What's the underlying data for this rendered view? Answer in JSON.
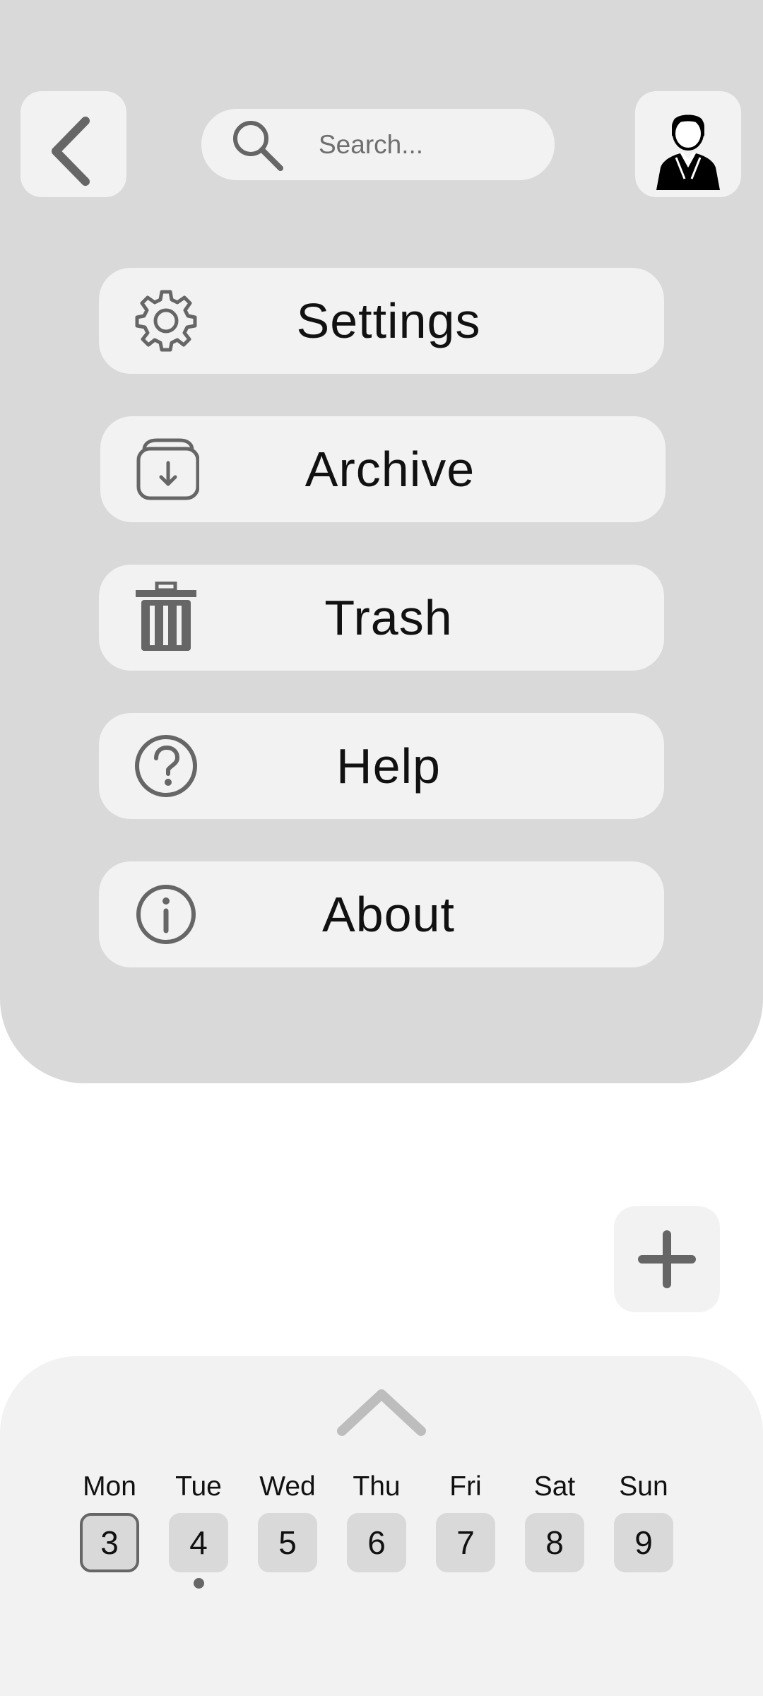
{
  "header": {
    "back_icon": "chevron-left-icon",
    "search": {
      "placeholder": "Search...",
      "icon": "search-icon"
    },
    "avatar_icon": "user-avatar-icon"
  },
  "menu": {
    "items": [
      {
        "label": "Settings",
        "icon": "gear-icon"
      },
      {
        "label": "Archive",
        "icon": "archive-icon"
      },
      {
        "label": "Trash",
        "icon": "trash-icon"
      },
      {
        "label": "Help",
        "icon": "help-circle-icon"
      },
      {
        "label": "About",
        "icon": "info-circle-icon"
      }
    ]
  },
  "fab": {
    "icon": "plus-icon"
  },
  "calendar": {
    "expand_icon": "chevron-up-icon",
    "days": [
      {
        "name": "Mon",
        "num": "3",
        "selected": true,
        "has_event": false
      },
      {
        "name": "Tue",
        "num": "4",
        "selected": false,
        "has_event": true
      },
      {
        "name": "Wed",
        "num": "5",
        "selected": false,
        "has_event": false
      },
      {
        "name": "Thu",
        "num": "6",
        "selected": false,
        "has_event": false
      },
      {
        "name": "Fri",
        "num": "7",
        "selected": false,
        "has_event": false
      },
      {
        "name": "Sat",
        "num": "8",
        "selected": false,
        "has_event": false
      },
      {
        "name": "Sun",
        "num": "9",
        "selected": false,
        "has_event": false
      }
    ]
  },
  "colors": {
    "panel_bg": "#d9d9d9",
    "card_bg": "#f2f2f2",
    "icon_gray": "#666666",
    "text": "#111111"
  }
}
